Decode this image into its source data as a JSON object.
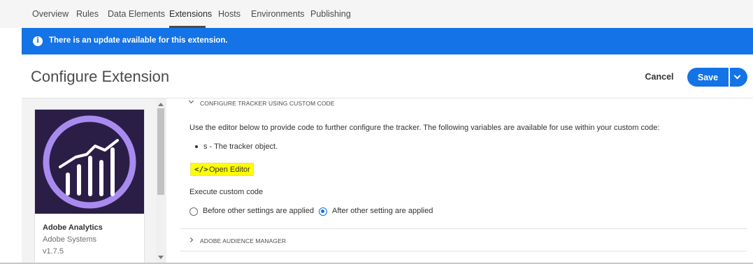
{
  "nav": {
    "tabs": [
      {
        "label": "Overview"
      },
      {
        "label": "Rules"
      },
      {
        "label": "Data Elements"
      },
      {
        "label": "Extensions",
        "active": true
      },
      {
        "label": "Hosts"
      },
      {
        "label": "Environments"
      },
      {
        "label": "Publishing"
      }
    ]
  },
  "banner": {
    "text": "There is an update available for this extension.",
    "icon": "info-icon",
    "color": "#1473e6"
  },
  "header": {
    "title": "Configure Extension",
    "cancel_label": "Cancel",
    "save_label": "Save"
  },
  "extension_card": {
    "name": "Adobe Analytics",
    "vendor": "Adobe Systems",
    "version": "v1.7.5",
    "icon": "adobe-analytics-logo"
  },
  "custom_code_section": {
    "heading": "CONFIGURE TRACKER USING CUSTOM CODE",
    "description": "Use the editor below to provide code to further configure the tracker. The following variables are available for use within your custom code:",
    "variables": [
      {
        "text": "s - The tracker object."
      }
    ],
    "open_editor_label": "Open Editor",
    "execute_label": "Execute custom code",
    "options": [
      {
        "label": "Before other settings are applied",
        "checked": false
      },
      {
        "label": "After other setting are applied",
        "checked": true
      }
    ]
  },
  "audience_section": {
    "heading": "ADOBE AUDIENCE MANAGER"
  },
  "colors": {
    "accent": "#1473e6",
    "highlight": "#ffff00",
    "logo_bg": "#2b1e46",
    "logo_stroke": "#a98bf0"
  }
}
